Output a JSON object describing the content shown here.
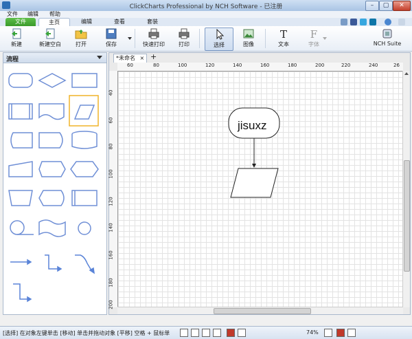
{
  "window": {
    "title": "ClickCharts Professional by NCH Software - 已注册"
  },
  "menu": [
    "文件",
    "编辑",
    "帮助"
  ],
  "ribbon_tabs": [
    "文件",
    "主页",
    "编辑",
    "查看",
    "套装"
  ],
  "active_tab": "主页",
  "toolbar": {
    "new": "新建",
    "new_blank": "新建空白",
    "open": "打开",
    "save": "保存",
    "quick_print": "快速打印",
    "print": "打印",
    "select": "选择",
    "image": "图像",
    "text": "文本",
    "font": "字体",
    "nch_suite": "NCH Suite"
  },
  "shape_panel": {
    "category": "流程"
  },
  "document": {
    "tab_name": "*未命名",
    "h_ruler_ticks": [
      "60",
      "80",
      "100",
      "120",
      "140",
      "160",
      "180",
      "200",
      "220",
      "240",
      "26"
    ],
    "v_ruler_ticks": [
      "40",
      "60",
      "80",
      "100",
      "120",
      "140",
      "160",
      "180",
      "200"
    ],
    "node_text": "jisuxz"
  },
  "status": {
    "text": "[选择] 在对象左键单击 [移动] 单击并拖动对象 [平移] 空格 + 鼠标单",
    "zoom": "74%"
  },
  "colors": {
    "shape_stroke": "#6f8fd6",
    "selected_highlight": "#f0b429",
    "file_tab": "#3a9a2a"
  }
}
